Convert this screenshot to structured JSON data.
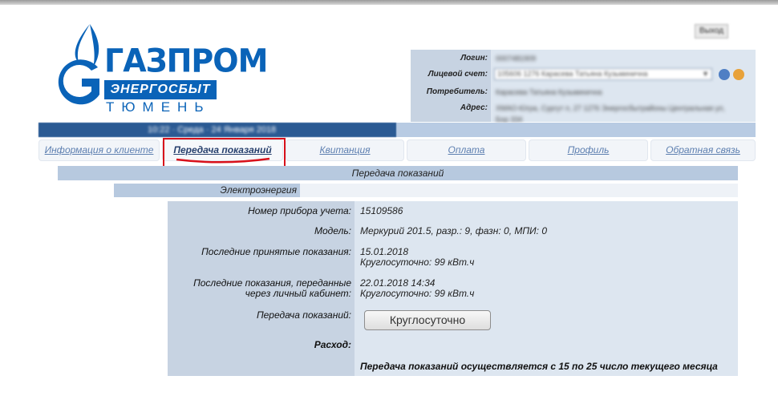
{
  "logo": {
    "name": "ГАЗПРОМ",
    "subtitle": "ЭНЕРГОСБЫТ",
    "city": "ТЮМЕНЬ",
    "color": "#0a63b8"
  },
  "header": {
    "exit_label": "Выход"
  },
  "account": {
    "rows": [
      {
        "label": "Логин:",
        "value": "0007481909"
      },
      {
        "label": "Лицевой счет:",
        "value": "105606 1276 Карасева Татьяна Кузьминична"
      },
      {
        "label": "Потребитель:",
        "value": "Карасева Татьяна Кузьминична"
      },
      {
        "label": "Адрес:",
        "value": "ХМАО-Югра, Сургут п, 27 1276 Энергосбытрайоны Центральная ул, Бор 334"
      }
    ],
    "select_value": "105606 1276 Карасева Татьяна Кузьминична",
    "date_text": "10:22 · Среда · 24 Января 2018"
  },
  "nav": {
    "tabs": [
      {
        "label": "Информация о клиенте",
        "active": false
      },
      {
        "label": "Передача показаний",
        "active": true
      },
      {
        "label": "Квитанция",
        "active": false
      },
      {
        "label": "Оплата",
        "active": false
      },
      {
        "label": "Профиль",
        "active": false
      },
      {
        "label": "Обратная связь",
        "active": false
      }
    ],
    "highlight_color": "#d8111b"
  },
  "page": {
    "title": "Передача показаний",
    "section": "Электроэнергия"
  },
  "meter": {
    "number_label": "Номер прибора учета:",
    "number_value": "15109586",
    "model_label": "Модель:",
    "model_value": "Меркурий 201.5, разр.: 9, фазн: 0, МПИ: 0",
    "last_accepted_label": "Последние принятые показания:",
    "last_accepted_date": "15.01.2018",
    "last_accepted_reading": "Круглосуточно: 99 кВт.ч",
    "last_sent_label_1": "Последние показания, переданные",
    "last_sent_label_2": "через личный кабинет:",
    "last_sent_date": "22.01.2018 14:34",
    "last_sent_reading": "Круглосуточно: 99 кВт.ч",
    "submit_label": "Передача показаний:",
    "submit_button": "Круглосуточно",
    "consumption_label": "Расход:",
    "notice": "Передача показаний осуществляется с 15 по 25 число текущего месяца"
  }
}
